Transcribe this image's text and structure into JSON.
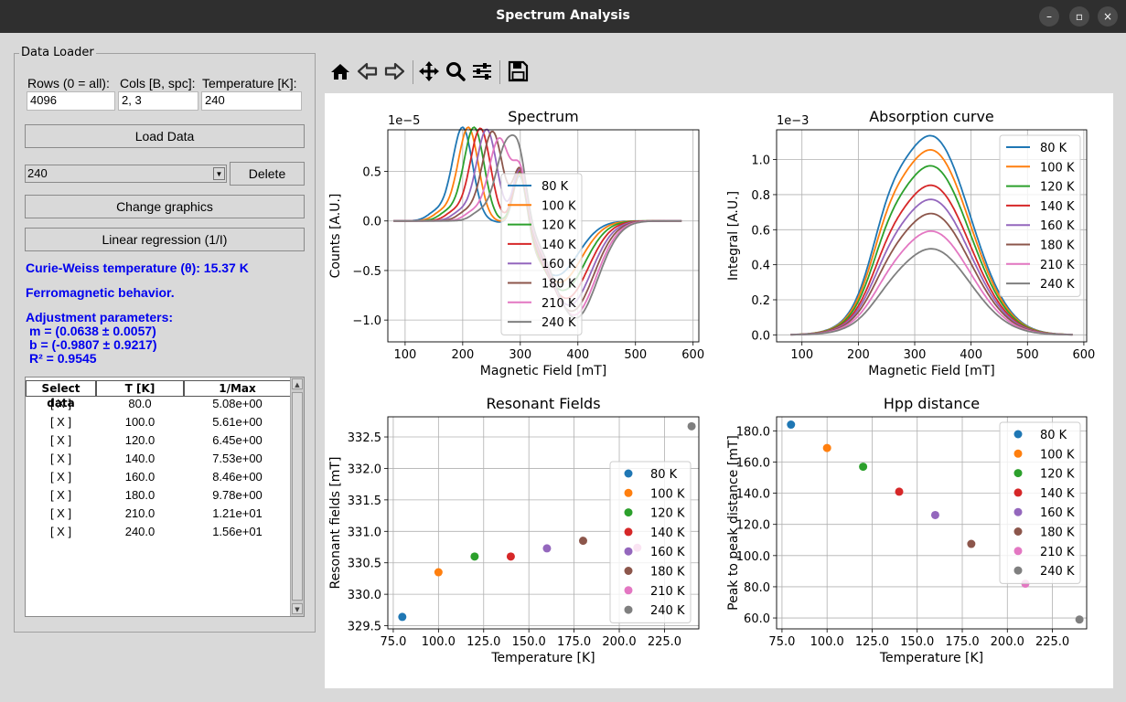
{
  "window": {
    "title": "Spectrum Analysis",
    "minimize": "–",
    "maximize": "▫",
    "close": "×"
  },
  "loader": {
    "group_title": "Data Loader",
    "rows_label": "Rows (0 = all):",
    "rows_value": "4096",
    "cols_label": "Cols [B, spc]:",
    "cols_value": "2, 3",
    "temp_label": "Temperature [K]:",
    "temp_value": "240",
    "load_button": "Load Data",
    "combo_value": "240",
    "delete_button": "Delete",
    "change_graphics_button": "Change graphics",
    "linreg_button": "Linear regression (1/I)",
    "curie_text": "Curie-Weiss temperature (θ): 15.37 K",
    "behavior_text": "Ferromagnetic behavior.",
    "adjust_title": "Adjustment parameters:",
    "adjust_m": "m = (0.0638 ± 0.0057)",
    "adjust_b": "b = (-0.9807 ± 0.9217)",
    "adjust_r2": "R² = 0.9545"
  },
  "table": {
    "headers": [
      "Select data",
      "T [K]",
      "1/Max"
    ],
    "rows": [
      [
        "[ X ]",
        "80.0",
        "5.08e+00"
      ],
      [
        "[ X ]",
        "100.0",
        "5.61e+00"
      ],
      [
        "[ X ]",
        "120.0",
        "6.45e+00"
      ],
      [
        "[ X ]",
        "140.0",
        "7.53e+00"
      ],
      [
        "[ X ]",
        "160.0",
        "8.46e+00"
      ],
      [
        "[ X ]",
        "180.0",
        "9.78e+00"
      ],
      [
        "[ X ]",
        "210.0",
        "1.21e+01"
      ],
      [
        "[ X ]",
        "240.0",
        "1.56e+01"
      ]
    ]
  },
  "toolbar": {
    "icons": [
      "home-icon",
      "back-icon",
      "forward-icon",
      "pan-icon",
      "zoom-icon",
      "configure-subplots-icon",
      "save-icon"
    ]
  },
  "series_colors": [
    "#1f77b4",
    "#ff7f0e",
    "#2ca02c",
    "#d62728",
    "#9467bd",
    "#8c564b",
    "#e377c2",
    "#7f7f7f"
  ],
  "chart_data": [
    {
      "type": "line",
      "title": "Spectrum",
      "xlabel": "Magnetic Field [mT]",
      "ylabel": "Counts [A.U.]",
      "offset_label": "1e−5",
      "xlim": [
        70,
        610
      ],
      "ylim": [
        -1.22,
        0.92
      ],
      "xticks": [
        100,
        200,
        300,
        400,
        500,
        600
      ],
      "yticks": [
        -1.0,
        -0.5,
        0.0,
        0.5
      ],
      "ytick_labels": [
        "−1.0",
        "−0.5",
        "0.0",
        "0.5"
      ],
      "legend_loc": "center",
      "series": [
        {
          "name": "80 K",
          "peak_pos": 200,
          "peak_val": 0.84,
          "trough_pos": 362,
          "trough_val": -0.55
        },
        {
          "name": "100 K",
          "peak_pos": 210,
          "peak_val": 0.84,
          "trough_pos": 368,
          "trough_val": -0.62
        },
        {
          "name": "120 K",
          "peak_pos": 220,
          "peak_val": 0.84,
          "trough_pos": 374,
          "trough_val": -0.7
        },
        {
          "name": "140 K",
          "peak_pos": 231,
          "peak_val": 0.83,
          "trough_pos": 380,
          "trough_val": -0.78
        },
        {
          "name": "160 K",
          "peak_pos": 242,
          "peak_val": 0.82,
          "trough_pos": 385,
          "trough_val": -0.85
        },
        {
          "name": "180 K",
          "peak_pos": 252,
          "peak_val": 0.8,
          "trough_pos": 389,
          "trough_val": -0.91
        },
        {
          "name": "210 K",
          "peak_pos": 264,
          "peak_val": 0.73,
          "trough_pos": 393,
          "trough_val": -0.95
        },
        {
          "name": "240 K",
          "peak_pos": 276,
          "peak_val": 0.66,
          "trough_pos": 396,
          "trough_val": -0.98
        }
      ]
    },
    {
      "type": "line",
      "title": "Absorption curve",
      "xlabel": "Magnetic Field [mT]",
      "ylabel": "Integral [A.U.]",
      "offset_label": "1e−3",
      "xlim": [
        55,
        605
      ],
      "ylim": [
        -0.04,
        1.17
      ],
      "xticks": [
        100,
        200,
        300,
        400,
        500,
        600
      ],
      "yticks": [
        0.0,
        0.2,
        0.4,
        0.6,
        0.8,
        1.0
      ],
      "ytick_labels": [
        "0.0",
        "0.2",
        "0.4",
        "0.6",
        "0.8",
        "1.0"
      ],
      "legend_loc": "upper right",
      "series": [
        {
          "name": "80 K",
          "peak": 1.13
        },
        {
          "name": "100 K",
          "peak": 1.05
        },
        {
          "name": "120 K",
          "peak": 0.96
        },
        {
          "name": "140 K",
          "peak": 0.85
        },
        {
          "name": "160 K",
          "peak": 0.77
        },
        {
          "name": "180 K",
          "peak": 0.69
        },
        {
          "name": "210 K",
          "peak": 0.59
        },
        {
          "name": "240 K",
          "peak": 0.49
        }
      ]
    },
    {
      "type": "scatter",
      "title": "Resonant Fields",
      "xlabel": "Temperature [K]",
      "ylabel": "Resonant fields [mT]",
      "xlim": [
        72,
        244
      ],
      "ylim": [
        329.45,
        332.82
      ],
      "xticks": [
        75,
        100,
        125,
        150,
        175,
        200,
        225
      ],
      "xtick_labels": [
        "75.0",
        "100.0",
        "125.0",
        "150.0",
        "175.0",
        "200.0",
        "225.0"
      ],
      "yticks": [
        329.5,
        330.0,
        330.5,
        331.0,
        331.5,
        332.0,
        332.5
      ],
      "ytick_labels": [
        "329.5",
        "330.0",
        "330.5",
        "331.0",
        "331.5",
        "332.0",
        "332.5"
      ],
      "legend_loc": "right",
      "series": [
        {
          "name": "80 K",
          "x": 80,
          "y": 329.64
        },
        {
          "name": "100 K",
          "x": 100,
          "y": 330.35
        },
        {
          "name": "120 K",
          "x": 120,
          "y": 330.6
        },
        {
          "name": "140 K",
          "x": 140,
          "y": 330.6
        },
        {
          "name": "160 K",
          "x": 160,
          "y": 330.73
        },
        {
          "name": "180 K",
          "x": 180,
          "y": 330.85
        },
        {
          "name": "210 K",
          "x": 210,
          "y": 330.74
        },
        {
          "name": "240 K",
          "x": 240,
          "y": 332.67
        }
      ]
    },
    {
      "type": "scatter",
      "title": "Hpp distance",
      "xlabel": "Temperature [K]",
      "ylabel": "Peak to peak distance [mT]",
      "xlim": [
        72,
        244
      ],
      "ylim": [
        53,
        189
      ],
      "xticks": [
        75,
        100,
        125,
        150,
        175,
        200,
        225
      ],
      "xtick_labels": [
        "75.0",
        "100.0",
        "125.0",
        "150.0",
        "175.0",
        "200.0",
        "225.0"
      ],
      "yticks": [
        60,
        80,
        100,
        120,
        140,
        160,
        180
      ],
      "ytick_labels": [
        "60.0",
        "80.0",
        "100.0",
        "120.0",
        "140.0",
        "160.0",
        "180.0"
      ],
      "legend_loc": "upper right",
      "series": [
        {
          "name": "80 K",
          "x": 80,
          "y": 184
        },
        {
          "name": "100 K",
          "x": 100,
          "y": 169
        },
        {
          "name": "120 K",
          "x": 120,
          "y": 157
        },
        {
          "name": "140 K",
          "x": 140,
          "y": 141
        },
        {
          "name": "160 K",
          "x": 160,
          "y": 126
        },
        {
          "name": "180 K",
          "x": 180,
          "y": 107.5
        },
        {
          "name": "210 K",
          "x": 210,
          "y": 82
        },
        {
          "name": "240 K",
          "x": 240,
          "y": 59
        }
      ]
    }
  ]
}
